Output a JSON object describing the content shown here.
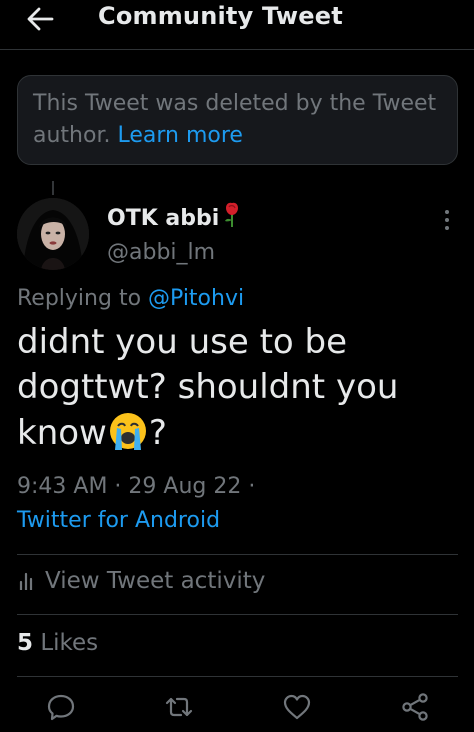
{
  "header": {
    "back_icon": "arrow-left-icon",
    "title": "Community Tweet"
  },
  "deleted_notice": {
    "text": "This Tweet was deleted by the Tweet author.",
    "link": "Learn more"
  },
  "tweet": {
    "author_name": "OTK abbi",
    "author_emoji": "rose-emoji",
    "handle": "@abbi_lm",
    "replying_prefix": "Replying to",
    "replying_to": "@Pitohvi",
    "text": "didnt you use to be dogttwt? shouldnt you know",
    "text_emoji": "loudly-crying-face-emoji",
    "text_suffix": "?",
    "timestamp": "9:43 AM · 29 Aug 22 ·",
    "source": "Twitter for Android"
  },
  "activity": {
    "icon": "analytics-icon",
    "label": "View Tweet activity"
  },
  "likes": {
    "count": "5",
    "label": "Likes"
  },
  "actions": [
    "reply-icon",
    "retweet-icon",
    "like-icon",
    "share-icon"
  ],
  "colors": {
    "background": "#000000",
    "text": "#e7e9ea",
    "secondary": "#71767b",
    "accent": "#1d9bf0",
    "border": "#2f3336"
  }
}
